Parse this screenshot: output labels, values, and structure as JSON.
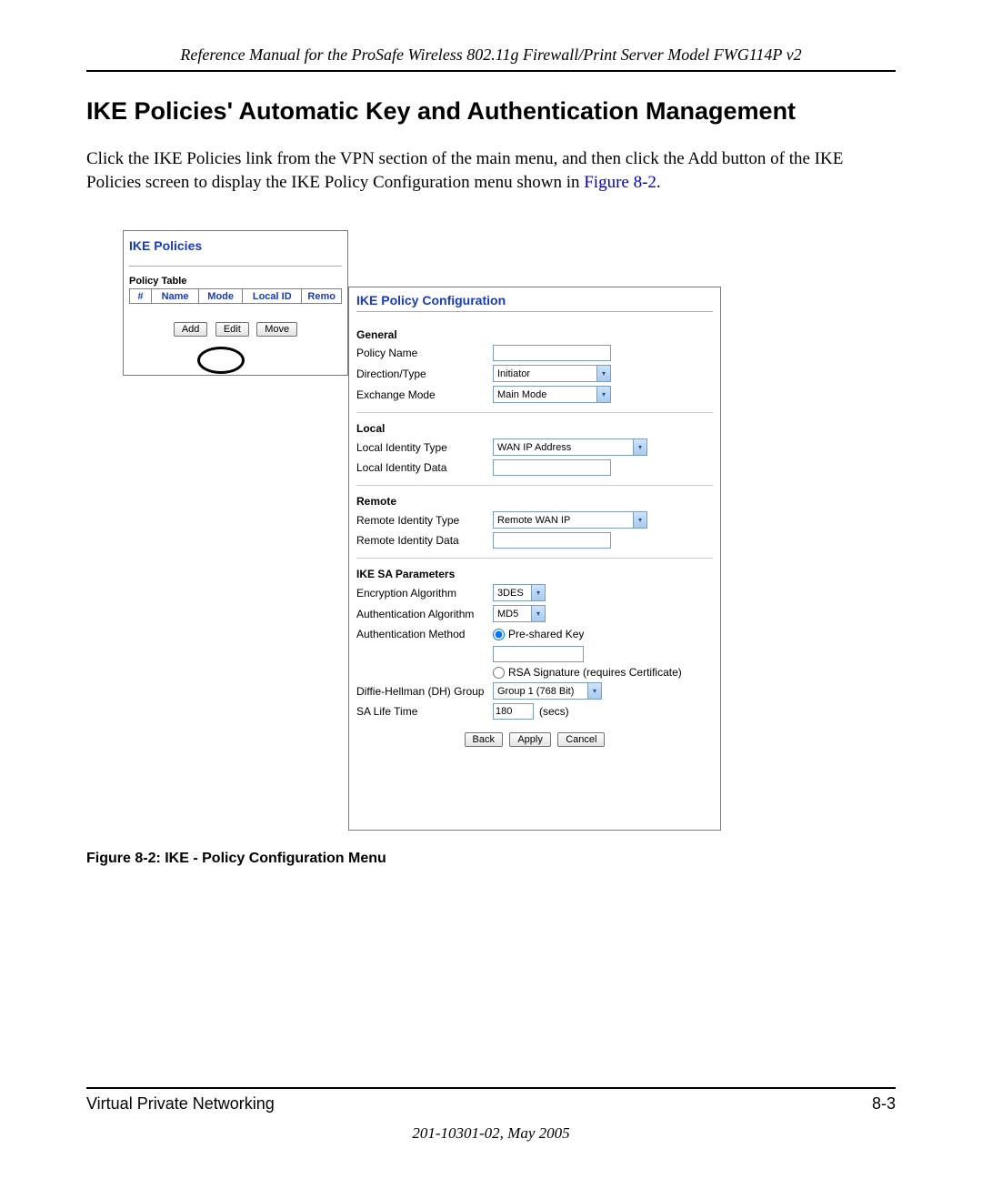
{
  "header": "Reference Manual for the ProSafe Wireless 802.11g  Firewall/Print Server Model FWG114P v2",
  "section_title": "IKE Policies' Automatic Key and Authentication Management",
  "body_text_1": "Click the IKE Policies link from the VPN section of the main menu, and then click the Add button of the IKE Policies screen to display the IKE Policy Configuration menu shown in ",
  "figure_ref": "Figure 8-2",
  "body_text_2": ".",
  "left": {
    "title": "IKE Policies",
    "table_label": "Policy Table",
    "cols": [
      "#",
      "Name",
      "Mode",
      "Local ID",
      "Remo"
    ],
    "buttons": {
      "add": "Add",
      "edit": "Edit",
      "move": "Move"
    }
  },
  "right": {
    "title": "IKE Policy Configuration",
    "general": {
      "hdr": "General",
      "policy_name_label": "Policy Name",
      "policy_name_value": "",
      "direction_label": "Direction/Type",
      "direction_value": "Initiator",
      "exchange_label": "Exchange Mode",
      "exchange_value": "Main Mode"
    },
    "local": {
      "hdr": "Local",
      "type_label": "Local Identity Type",
      "type_value": "WAN IP Address",
      "data_label": "Local Identity Data",
      "data_value": ""
    },
    "remote": {
      "hdr": "Remote",
      "type_label": "Remote Identity Type",
      "type_value": "Remote WAN IP",
      "data_label": "Remote Identity Data",
      "data_value": ""
    },
    "sa": {
      "hdr": "IKE SA Parameters",
      "enc_label": "Encryption Algorithm",
      "enc_value": "3DES",
      "auth_alg_label": "Authentication Algorithm",
      "auth_alg_value": "MD5",
      "auth_method_label": "Authentication Method",
      "psk_label": "Pre-shared Key",
      "psk_value": "",
      "rsa_label": "RSA Signature (requires Certificate)",
      "dh_label": "Diffie-Hellman (DH) Group",
      "dh_value": "Group 1 (768 Bit)",
      "life_label": "SA Life Time",
      "life_value": "180",
      "life_unit": "(secs)"
    },
    "buttons": {
      "back": "Back",
      "apply": "Apply",
      "cancel": "Cancel"
    }
  },
  "figure_caption": "Figure 8-2:  IKE - Policy Configuration Menu",
  "footer": {
    "left": "Virtual Private Networking",
    "right": "8-3",
    "doc": "201-10301-02, May 2005"
  }
}
